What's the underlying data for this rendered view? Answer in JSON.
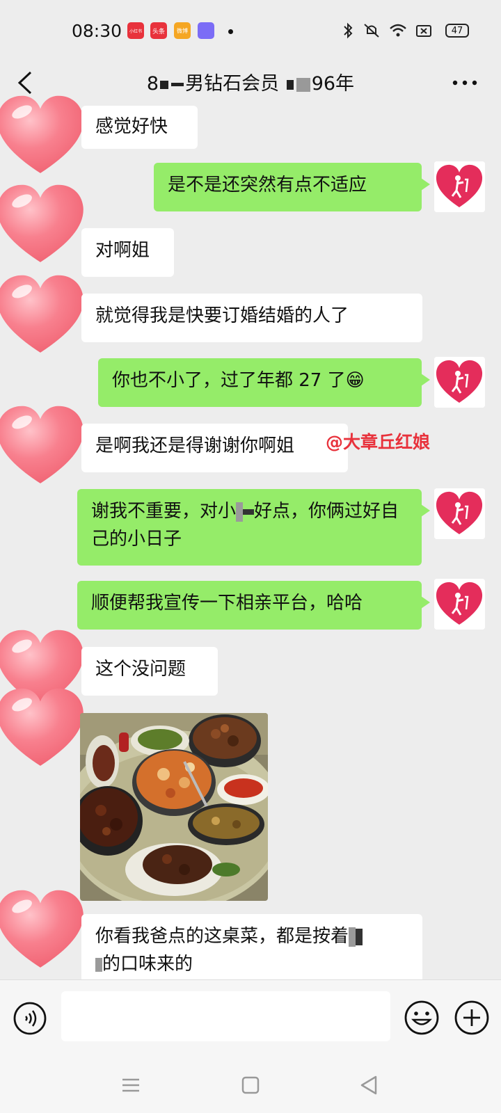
{
  "status_bar": {
    "time": "08:30",
    "apps": [
      "小红书",
      "头条",
      "微博"
    ],
    "battery": "47"
  },
  "header": {
    "title_part1": "8",
    "title_part2": "男钻石会员",
    "title_part3": "96年"
  },
  "messages": [
    {
      "side": "in",
      "text": "感觉好快"
    },
    {
      "side": "out",
      "text": "是不是还突然有点不适应"
    },
    {
      "side": "in",
      "text": "对啊姐"
    },
    {
      "side": "in",
      "text": "就觉得我是快要订婚结婚的人了"
    },
    {
      "side": "out",
      "text_a": "你也不小了，过了年都 27 了",
      "emoji": "😁"
    },
    {
      "side": "in",
      "text": "是啊我还是得谢谢你啊姐"
    },
    {
      "side": "out",
      "text_a": "谢我不重要，对小",
      "text_b": "好点，你俩过好自己的小日子"
    },
    {
      "side": "out",
      "text": "顺便帮我宣传一下相亲平台，哈哈"
    },
    {
      "side": "in",
      "text": "这个没问题"
    },
    {
      "side": "in",
      "text_a": "你看我爸点的这桌菜，都是按着",
      "text_b": "的口味来的"
    }
  ],
  "watermark": "@大章丘红娘",
  "input": {
    "value": "",
    "placeholder": ""
  },
  "colors": {
    "background": "#ededed",
    "outgoing_bubble": "#95ec69",
    "incoming_bubble": "#ffffff",
    "heart": "#f5707f",
    "watermark": "#e8323c"
  },
  "icons": [
    "back-arrow-icon",
    "more-dots-icon",
    "voice-icon",
    "emoji-icon",
    "plus-icon",
    "heart-avatar-icon",
    "menu-nav-icon",
    "home-nav-icon",
    "back-nav-icon"
  ]
}
